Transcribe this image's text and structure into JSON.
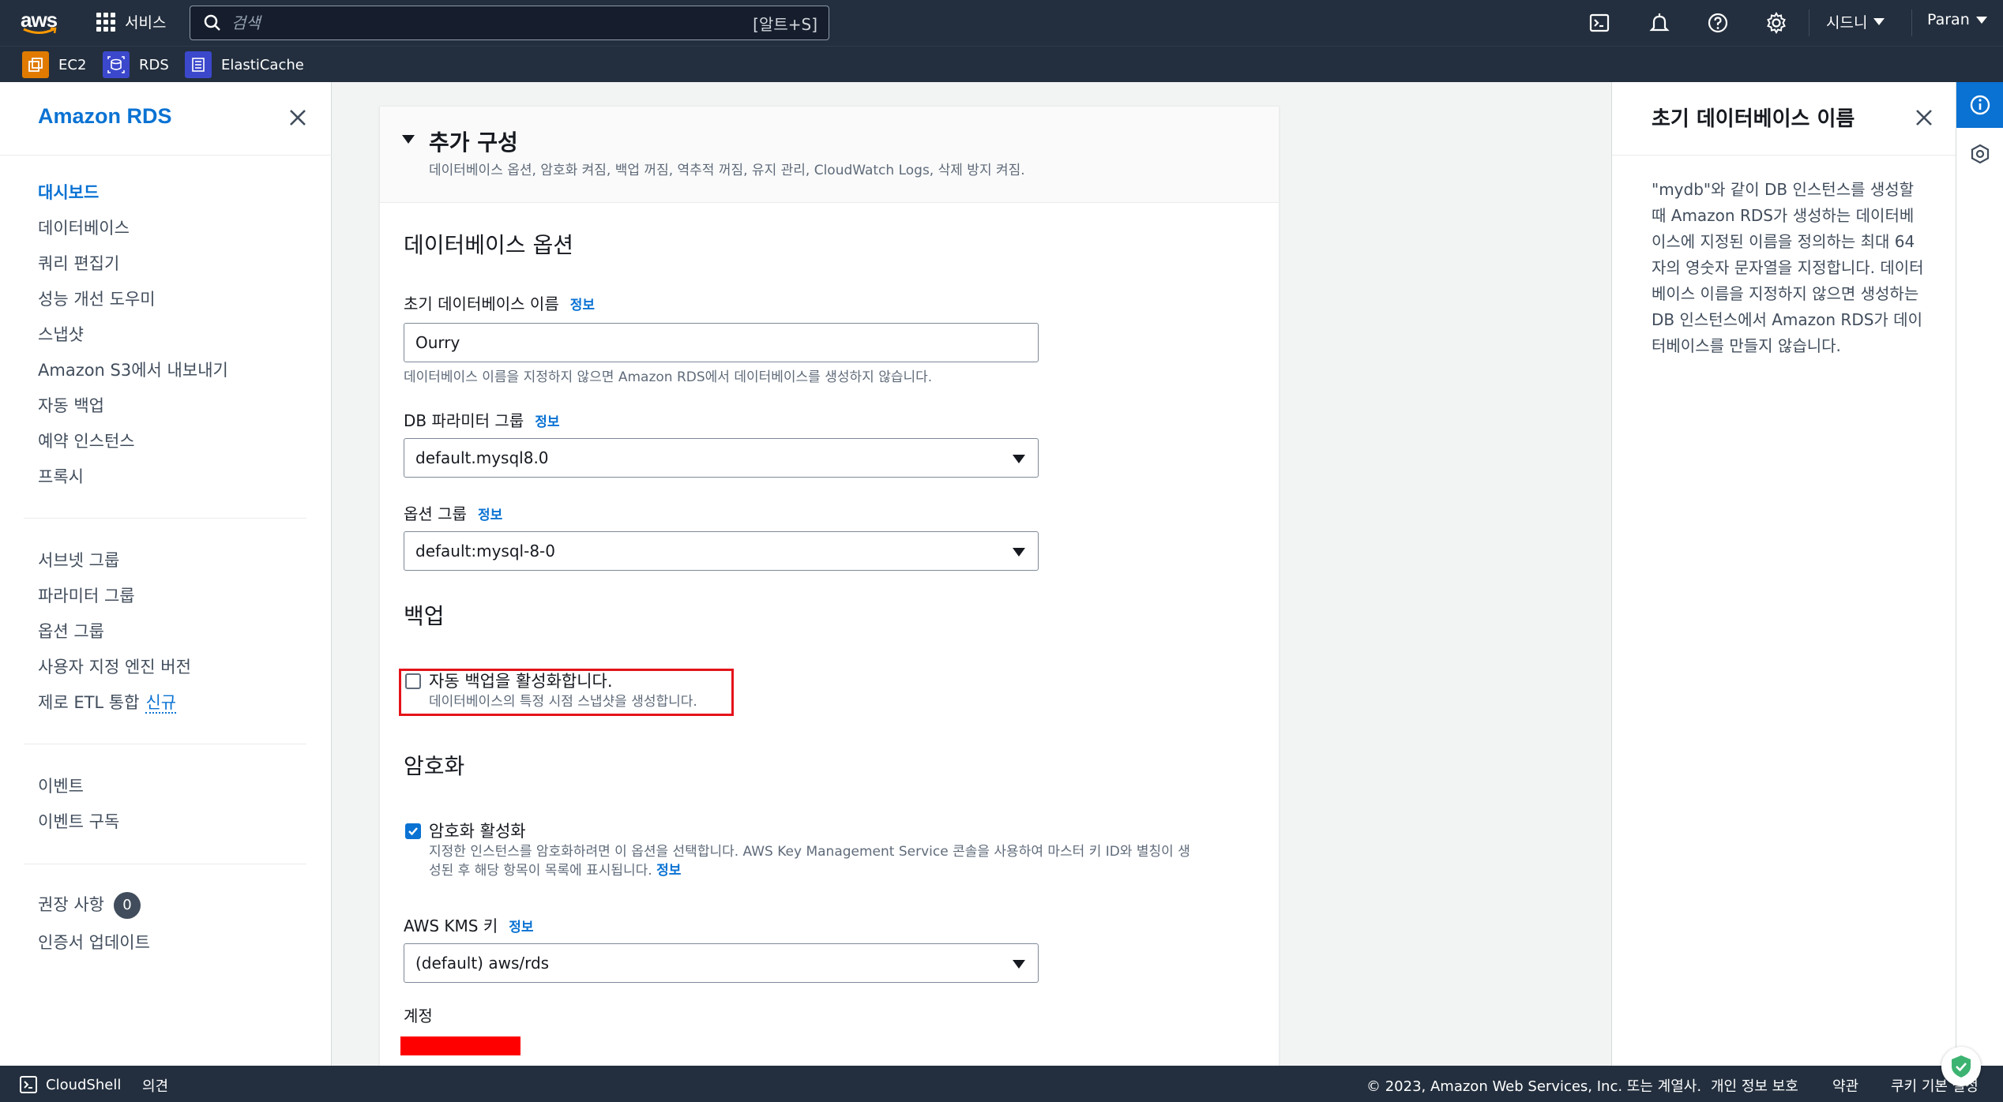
{
  "topnav": {
    "logo": "aws",
    "services_label": "서비스",
    "search_placeholder": "검색",
    "search_shortcut": "[알트+S]",
    "region": "시드니",
    "user": "Paran"
  },
  "favorites": [
    {
      "label": "EC2",
      "color": "#e07b00"
    },
    {
      "label": "RDS",
      "color": "#3b48cc"
    },
    {
      "label": "ElastiCache",
      "color": "#3b48cc"
    }
  ],
  "sidebar": {
    "title": "Amazon RDS",
    "group1": [
      "대시보드",
      "데이터베이스",
      "쿼리 편집기",
      "성능 개선 도우미",
      "스냅샷",
      "Amazon S3에서 내보내기",
      "자동 백업",
      "예약 인스턴스",
      "프록시"
    ],
    "group2": [
      "서브넷 그룹",
      "파라미터 그룹",
      "옵션 그룹",
      "사용자 지정 엔진 버전",
      "제로 ETL 통합"
    ],
    "new_tag": "신규",
    "group3": [
      "이벤트",
      "이벤트 구독"
    ],
    "group4": [
      "권장 사항",
      "인증서 업데이트"
    ],
    "recommendations_count": "0"
  },
  "main": {
    "section_title": "추가 구성",
    "section_desc": "데이터베이스 옵션, 암호화 켜짐, 백업 꺼짐, 역추적 꺼짐, 유지 관리, CloudWatch Logs, 삭제 방지 켜짐.",
    "db_options_heading": "데이터베이스 옵션",
    "initial_db_label": "초기 데이터베이스 이름",
    "info": "정보",
    "initial_db_value": "Ourry",
    "initial_db_help": "데이터베이스 이름을 지정하지 않으면 Amazon RDS에서 데이터베이스를 생성하지 않습니다.",
    "param_group_label": "DB 파라미터 그룹",
    "param_group_value": "default.mysql8.0",
    "option_group_label": "옵션 그룹",
    "option_group_value": "default:mysql-8-0",
    "backup_heading": "백업",
    "backup_checkbox_label": "자동 백업을 활성화합니다.",
    "backup_checkbox_desc": "데이터베이스의 특정 시점 스냅샷을 생성합니다.",
    "backup_checked": false,
    "encryption_heading": "암호화",
    "encryption_checkbox_label": "암호화 활성화",
    "encryption_desc_line1": "지정한 인스턴스를 암호화하려면 이 옵션을 선택합니다. AWS Key Management Service 콘솔을 사용하여 마스터 키 ID와 별칭이 생",
    "encryption_desc_line2": "성된 후 해당 항목이 목록에 표시됩니다.",
    "encryption_checked": true,
    "kms_label": "AWS KMS 키",
    "kms_value": "(default) aws/rds",
    "account_label": "계정"
  },
  "help_panel": {
    "title": "초기 데이터베이스 이름",
    "body": "\"mydb\"와 같이 DB 인스턴스를 생성할 때 Amazon RDS가 생성하는 데이터베이스에 지정된 이름을 정의하는 최대 64자의 영숫자 문자열을 지정합니다. 데이터베이스 이름을 지정하지 않으면 생성하는 DB 인스턴스에서 Amazon RDS가 데이터베이스를 만들지 않습니다."
  },
  "footer": {
    "cloudshell": "CloudShell",
    "feedback": "의견",
    "copyright": "© 2023, Amazon Web Services, Inc. 또는 계열사.",
    "privacy": "개인 정보 보호",
    "terms": "약관",
    "cookies": "쿠키 기본 설정"
  },
  "colors": {
    "nav_bg": "#232f3e",
    "accent": "#0972d3",
    "highlight": "#e5131a"
  }
}
